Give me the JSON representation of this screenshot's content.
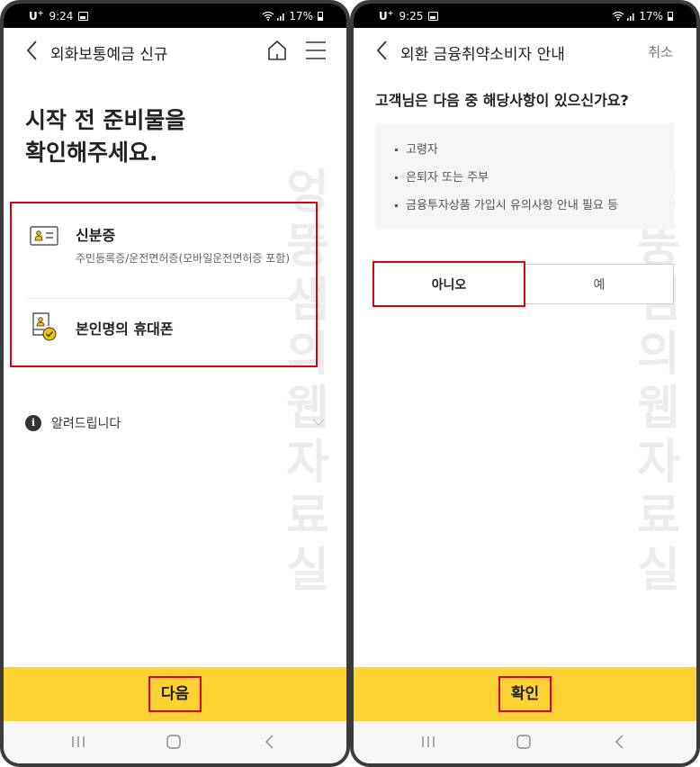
{
  "left_screen": {
    "status_bar": {
      "carrier": "U",
      "carrier_sup": "+",
      "time": "9:24",
      "battery": "17%"
    },
    "app_bar": {
      "title": "외화보통예금 신규"
    },
    "headline_line1": "시작 전 준비물을",
    "headline_line2": "확인해주세요.",
    "prep_items": [
      {
        "label": "신분증",
        "desc": "주민등록증/운전면허증(모바일운전면허증 포함)"
      },
      {
        "label": "본인명의 휴대폰"
      }
    ],
    "notice": {
      "label": "알려드립니다",
      "info_glyph": "i"
    },
    "bottom_button": {
      "label": "다음"
    }
  },
  "right_screen": {
    "status_bar": {
      "carrier": "U",
      "carrier_sup": "+",
      "time": "9:25",
      "battery": "17%"
    },
    "app_bar": {
      "title": "외환 금융취약소비자 안내",
      "cancel_label": "취소"
    },
    "question": "고객님은 다음 중 해당사항이 있으신가요?",
    "criteria": [
      "고령자",
      "은퇴자 또는 주부",
      "금융투자상품 가입시 유의사항 안내 필요 등"
    ],
    "choice": {
      "no_label": "아니오",
      "yes_label": "예",
      "selected": "아니오"
    },
    "bottom_button": {
      "label": "확인"
    }
  },
  "watermark": [
    "엉",
    "뚱",
    "샘",
    "의",
    "웹",
    "자",
    "료",
    "실"
  ],
  "colors": {
    "accent_yellow": "#fed233",
    "highlight_red": "#e0000b"
  }
}
